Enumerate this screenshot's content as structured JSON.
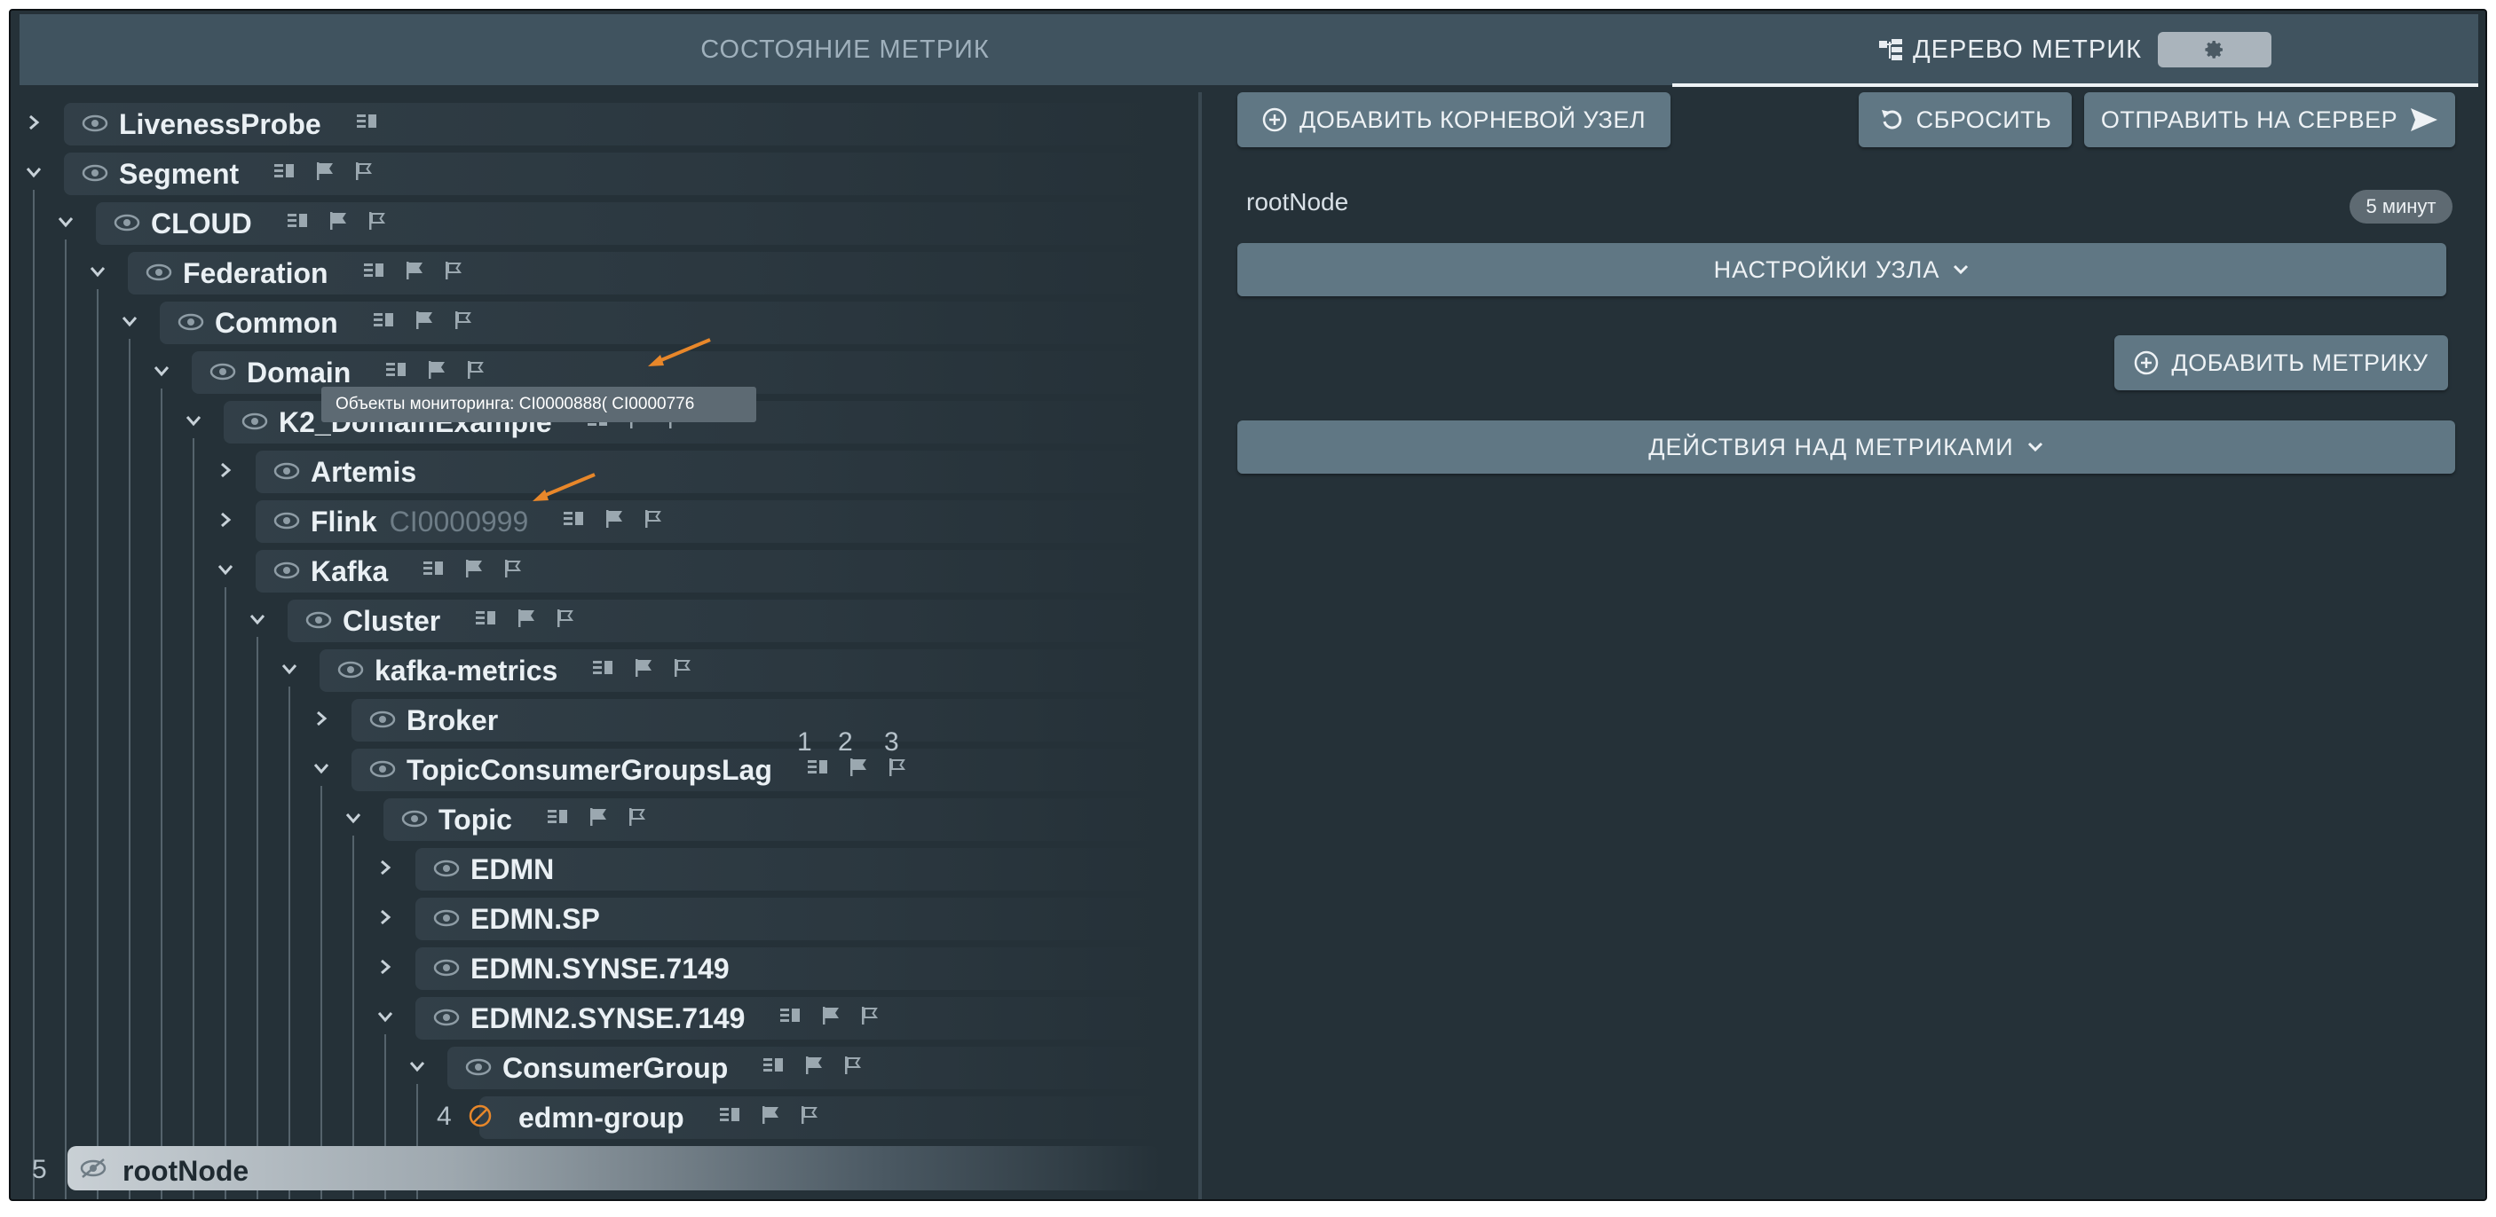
{
  "tabs": {
    "state": "СОСТОЯНИЕ МЕТРИК",
    "tree": "ДЕРЕВО МЕТРИК"
  },
  "tree": {
    "nodes": [
      {
        "label": "LivenessProbe"
      },
      {
        "label": "Segment"
      },
      {
        "label": "CLOUD"
      },
      {
        "label": "Federation"
      },
      {
        "label": "Common"
      },
      {
        "label": "Domain"
      },
      {
        "label": "K2_DomainExample"
      },
      {
        "label": "Artemis"
      },
      {
        "label": "Flink",
        "ci": "CI0000999"
      },
      {
        "label": "Kafka"
      },
      {
        "label": "Cluster"
      },
      {
        "label": "kafka-metrics"
      },
      {
        "label": "Broker"
      },
      {
        "label": "TopicConsumerGroupsLag"
      },
      {
        "label": "Topic"
      },
      {
        "label": "EDMN"
      },
      {
        "label": "EDMN.SP"
      },
      {
        "label": "EDMN.SYNSE.7149"
      },
      {
        "label": "EDMN2.SYNSE.7149"
      },
      {
        "label": "ConsumerGroup"
      },
      {
        "label": "edmn-group"
      }
    ],
    "tooltip": "Объекты мониторинга: CI0000888( CI0000776",
    "annotations": {
      "n1": "1",
      "n2": "2",
      "n3": "3",
      "n4": "4",
      "n5": "5"
    },
    "root_label": "rootNode"
  },
  "panel": {
    "add_root_node": "ДОБАВИТЬ КОРНЕВОЙ УЗЕЛ",
    "reset": "СБРОСИТЬ",
    "send_to_server": "ОТПРАВИТЬ НА СЕРВЕР",
    "root_name": "rootNode",
    "interval_badge": "5 минут",
    "node_settings": "НАСТРОЙКИ УЗЛА",
    "add_metric": "ДОБАВИТЬ МЕТРИКУ",
    "metric_actions": "ДЕЙСТВИЯ НАД МЕТРИКАМИ"
  },
  "colors": {
    "background": "#253138",
    "tab_bar": "#40535f",
    "button": "#607784",
    "annotation_arrow": "#e8872a",
    "disabled_icon": "#e8872a"
  },
  "icons": [
    "chevron-right-icon",
    "chevron-down-icon",
    "eye-icon",
    "eye-off-icon",
    "list-icon",
    "flag-filled-icon",
    "flag-outline-icon",
    "gear-icon",
    "plus-circle-icon",
    "reset-icon",
    "send-icon",
    "tree-icon",
    "ban-icon"
  ]
}
